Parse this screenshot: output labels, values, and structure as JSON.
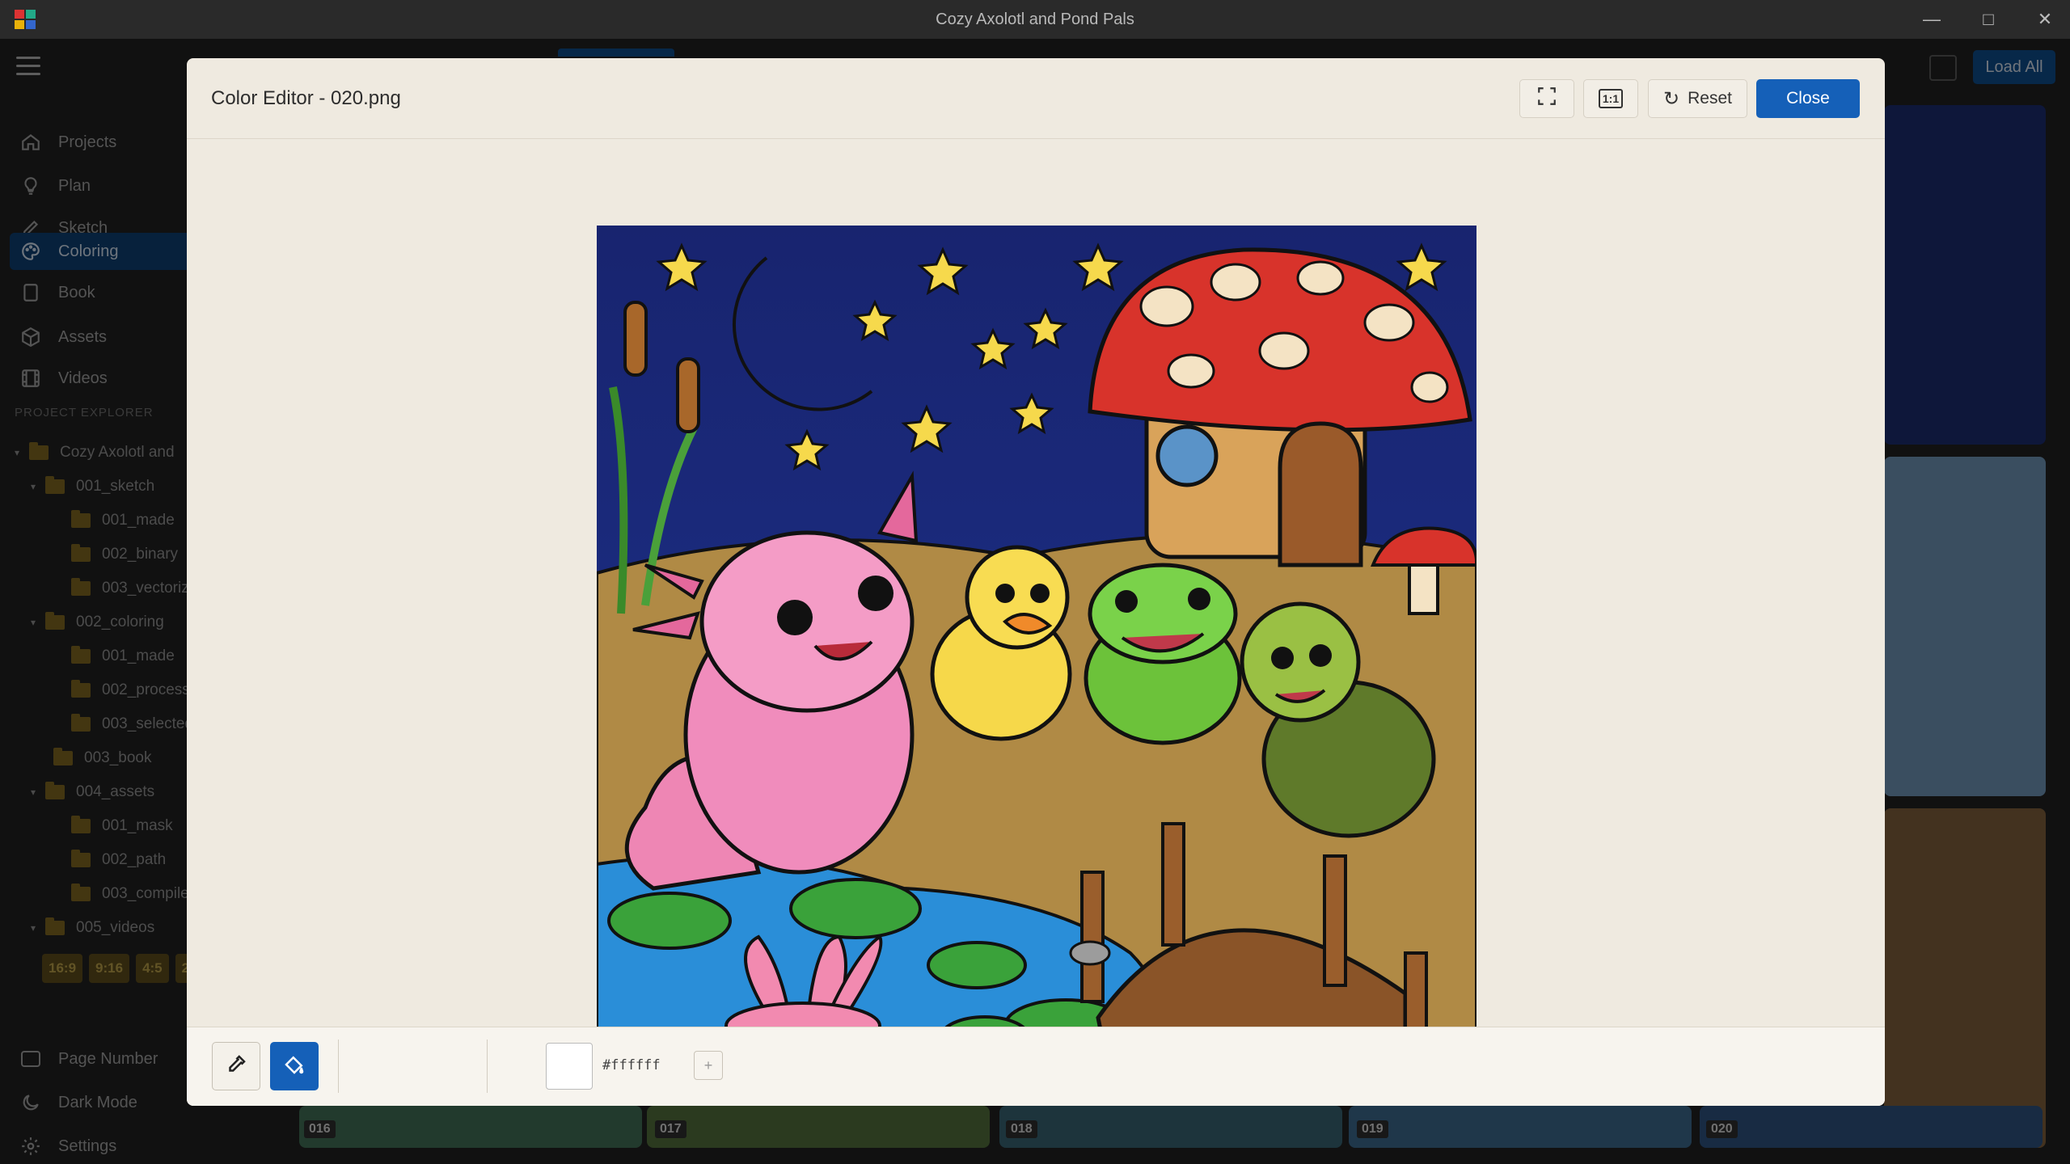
{
  "window": {
    "title": "Cozy Axolotl and Pond Pals",
    "minimize": "—",
    "maximize": "□",
    "close": "✕"
  },
  "toolbar": {
    "load_all": "Load All"
  },
  "sidebar": {
    "nav": [
      {
        "label": "Projects",
        "icon": "home-icon"
      },
      {
        "label": "Plan",
        "icon": "lightbulb-icon"
      },
      {
        "label": "Sketch",
        "icon": "pen-icon"
      },
      {
        "label": "Coloring",
        "icon": "palette-icon"
      },
      {
        "label": "Book",
        "icon": "book-icon"
      },
      {
        "label": "Assets",
        "icon": "cube-icon"
      },
      {
        "label": "Videos",
        "icon": "film-icon"
      }
    ],
    "section_label": "PROJECT EXPLORER",
    "tree": [
      {
        "label": "Cozy Axolotl and",
        "caret": "▾"
      },
      {
        "label": "001_sketch",
        "caret": "▾"
      },
      {
        "label": "001_made",
        "caret": ""
      },
      {
        "label": "002_binary",
        "caret": ""
      },
      {
        "label": "003_vectoriz",
        "caret": ""
      },
      {
        "label": "002_coloring",
        "caret": "▾"
      },
      {
        "label": "001_made",
        "caret": ""
      },
      {
        "label": "002_process",
        "caret": ""
      },
      {
        "label": "003_selected",
        "caret": ""
      },
      {
        "label": "003_book",
        "caret": ""
      },
      {
        "label": "004_assets",
        "caret": "▾"
      },
      {
        "label": "001_mask",
        "caret": ""
      },
      {
        "label": "002_path",
        "caret": ""
      },
      {
        "label": "003_compile",
        "caret": ""
      },
      {
        "label": "005_videos",
        "caret": "▾"
      }
    ],
    "ratios": [
      "16:9",
      "9:16",
      "4:5",
      "2:"
    ],
    "bottom": [
      {
        "label": "Page Number",
        "icon": "page-number-icon"
      },
      {
        "label": "Dark Mode",
        "icon": "moon-icon"
      },
      {
        "label": "Settings",
        "icon": "gear-icon"
      }
    ]
  },
  "thumbs": [
    "016",
    "017",
    "018",
    "019",
    "020"
  ],
  "modal": {
    "title": "Color Editor - 020.png",
    "reset_label": "Reset",
    "close_label": "Close",
    "fullscreen_icon": "⛶",
    "actual_size_icon": "1:1",
    "reset_icon": "↻",
    "current_color_hex": "#ffffff",
    "add_label": "+",
    "image_alt": "Colored illustration: axolotl, duckling, frog and turtle by a pond at night with a mushroom house and bridge",
    "colors": {
      "accent": "#1560b8",
      "selected_tool": "#1560b8",
      "modal_bg": "#efeae0"
    }
  }
}
